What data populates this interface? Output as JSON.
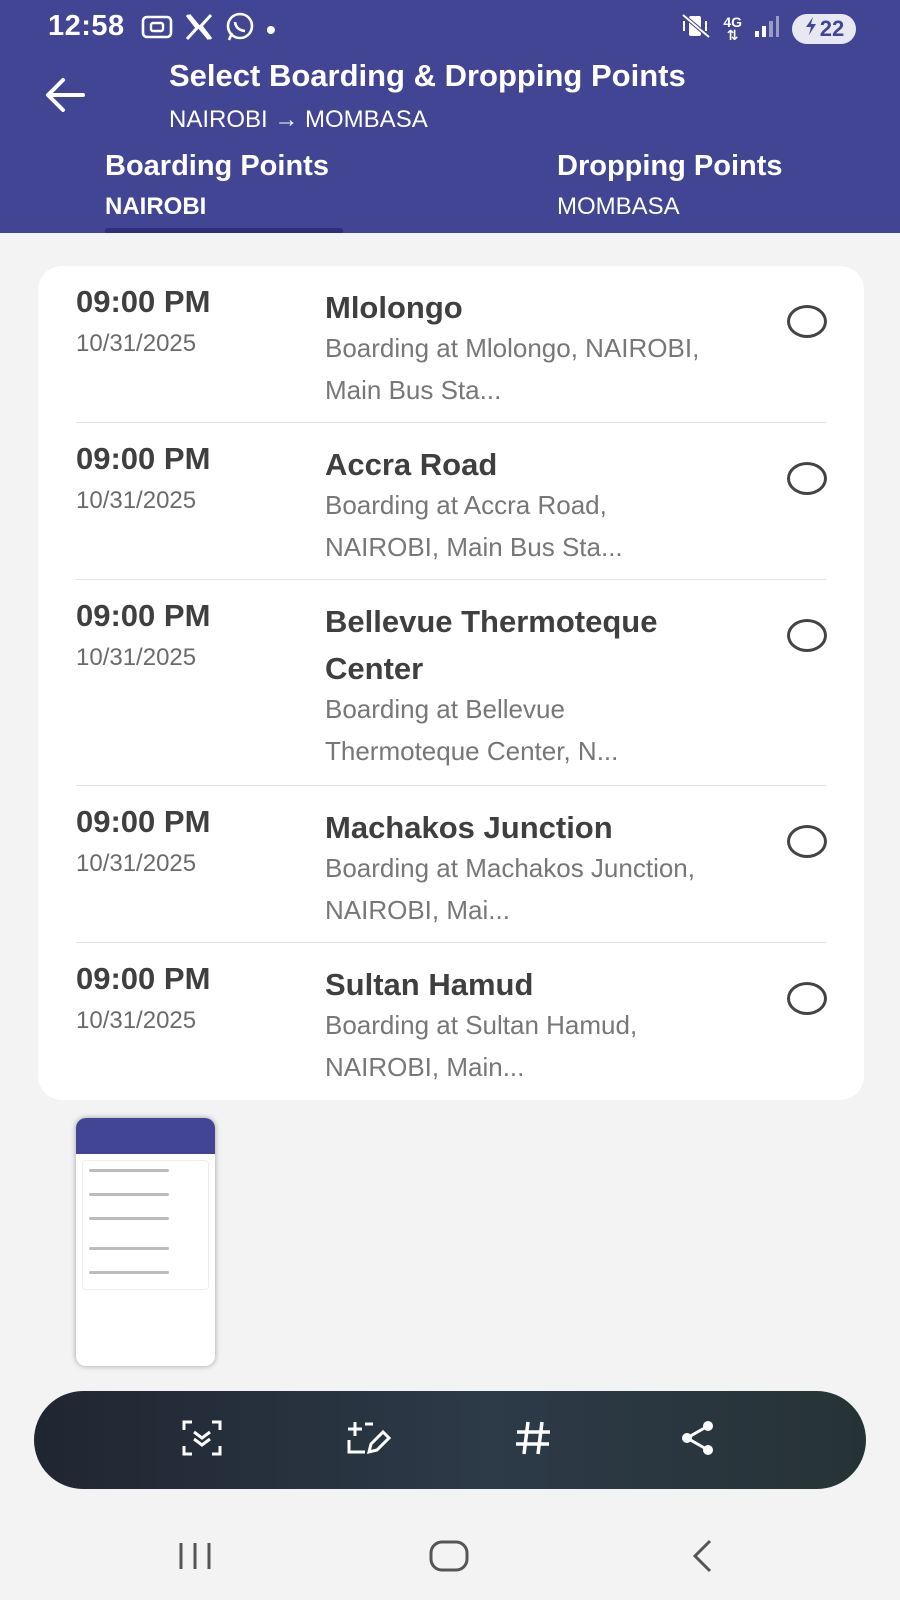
{
  "status_bar": {
    "time": "12:58",
    "battery": "22",
    "network": "4G",
    "dot": "•",
    "left_icons": [
      "screen-record-icon",
      "x-icon",
      "whatsapp-icon"
    ],
    "right_icons": [
      "vibrate-mute-icon",
      "network-4g-icon",
      "signal-icon",
      "battery-charging-icon"
    ]
  },
  "header": {
    "title": "Select Boarding & Dropping Points",
    "subtitle": "NAIROBI → MOMBASA",
    "background": "#414594"
  },
  "tabs": [
    {
      "label": "Boarding Points",
      "sub": "NAIROBI",
      "active": true
    },
    {
      "label": "Dropping Points",
      "sub": "MOMBASA",
      "active": false
    }
  ],
  "points": [
    {
      "time": "09:00 PM",
      "date": "10/31/2025",
      "name": "Mlolongo",
      "desc": "Boarding at Mlolongo, NAIROBI, Main Bus Sta...",
      "selected": false
    },
    {
      "time": "09:00 PM",
      "date": "10/31/2025",
      "name": "Accra Road",
      "desc": "Boarding at Accra Road, NAIROBI, Main Bus Sta...",
      "selected": false
    },
    {
      "time": "09:00 PM",
      "date": "10/31/2025",
      "name": "Bellevue Thermoteque Center",
      "desc": "Boarding at Bellevue Thermoteque Center, N...",
      "selected": false
    },
    {
      "time": "09:00 PM",
      "date": "10/31/2025",
      "name": "Machakos Junction",
      "desc": "Boarding at Machakos Junction, NAIROBI, Mai...",
      "selected": false
    },
    {
      "time": "09:00 PM",
      "date": "10/31/2025",
      "name": "Sultan Hamud",
      "desc": "Boarding at Sultan Hamud, NAIROBI, Main...",
      "selected": false
    }
  ],
  "toolbar": {
    "icons": [
      "scroll-capture-icon",
      "edit-screenshot-icon",
      "hashtag-icon",
      "share-icon"
    ]
  },
  "nav_bar": {
    "icons": [
      "recents-icon",
      "home-icon",
      "back-icon"
    ]
  }
}
